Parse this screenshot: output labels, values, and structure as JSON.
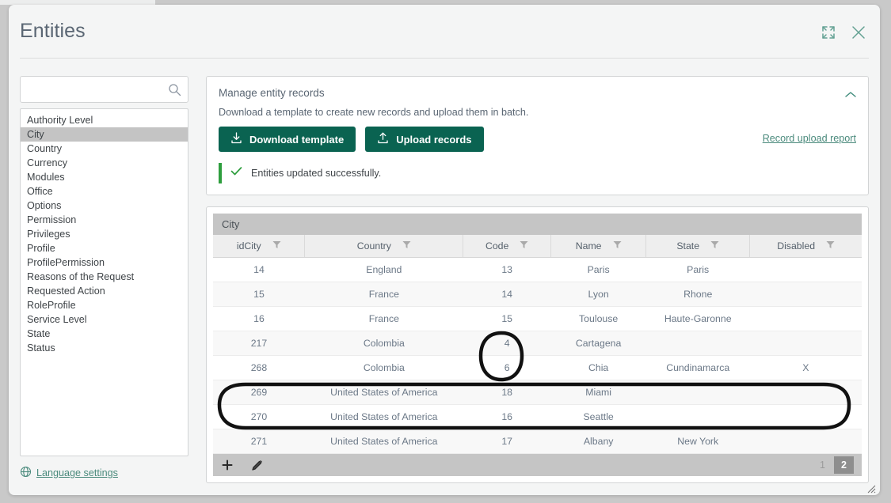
{
  "window": {
    "title": "Entities",
    "expand_icon": "expand-icon",
    "close_icon": "close-icon"
  },
  "sidebar": {
    "search": {
      "value": "",
      "placeholder": "",
      "icon": "search-icon"
    },
    "items": [
      {
        "label": "Authority Level",
        "selected": false
      },
      {
        "label": "City",
        "selected": true
      },
      {
        "label": "Country",
        "selected": false
      },
      {
        "label": "Currency",
        "selected": false
      },
      {
        "label": "Modules",
        "selected": false
      },
      {
        "label": "Office",
        "selected": false
      },
      {
        "label": "Options",
        "selected": false
      },
      {
        "label": "Permission",
        "selected": false
      },
      {
        "label": "Privileges",
        "selected": false
      },
      {
        "label": "Profile",
        "selected": false
      },
      {
        "label": "ProfilePermission",
        "selected": false
      },
      {
        "label": "Reasons of the Request",
        "selected": false
      },
      {
        "label": "Requested Action",
        "selected": false
      },
      {
        "label": "RoleProfile",
        "selected": false
      },
      {
        "label": "Service Level",
        "selected": false
      },
      {
        "label": "State",
        "selected": false
      },
      {
        "label": "Status",
        "selected": false
      }
    ],
    "language_settings": {
      "label": "Language settings",
      "icon": "globe-icon"
    }
  },
  "manage_panel": {
    "title": "Manage entity records",
    "subtitle": "Download a template to create new records and upload them in batch.",
    "download_button": "Download template",
    "upload_button": "Upload records",
    "report_link": "Record upload report",
    "success_message": "Entities updated successfully.",
    "collapse_icon": "chevron-up-icon"
  },
  "grid": {
    "title": "City",
    "columns": [
      {
        "label": "idCity",
        "filter_icon": "filter-icon"
      },
      {
        "label": "Country",
        "filter_icon": "filter-icon"
      },
      {
        "label": "Code",
        "filter_icon": "filter-icon"
      },
      {
        "label": "Name",
        "filter_icon": "filter-icon"
      },
      {
        "label": "State",
        "filter_icon": "filter-icon"
      },
      {
        "label": "Disabled",
        "filter_icon": "filter-icon"
      }
    ],
    "rows": [
      {
        "idCity": "14",
        "Country": "England",
        "Code": "13",
        "Name": "Paris",
        "State": "Paris",
        "Disabled": ""
      },
      {
        "idCity": "15",
        "Country": "France",
        "Code": "14",
        "Name": "Lyon",
        "State": "Rhone",
        "Disabled": ""
      },
      {
        "idCity": "16",
        "Country": "France",
        "Code": "15",
        "Name": "Toulouse",
        "State": "Haute-Garonne",
        "Disabled": ""
      },
      {
        "idCity": "217",
        "Country": "Colombia",
        "Code": "4",
        "Name": "Cartagena",
        "State": "",
        "Disabled": ""
      },
      {
        "idCity": "268",
        "Country": "Colombia",
        "Code": "6",
        "Name": "Chia",
        "State": "Cundinamarca",
        "Disabled": "X"
      },
      {
        "idCity": "269",
        "Country": "United States of America",
        "Code": "18",
        "Name": "Miami",
        "State": "",
        "Disabled": ""
      },
      {
        "idCity": "270",
        "Country": "United States of America",
        "Code": "16",
        "Name": "Seattle",
        "State": "",
        "Disabled": ""
      },
      {
        "idCity": "271",
        "Country": "United States of America",
        "Code": "17",
        "Name": "Albany",
        "State": "New York",
        "Disabled": ""
      }
    ],
    "footer": {
      "add_icon": "plus-icon",
      "edit_icon": "pencil-icon",
      "pages": [
        {
          "label": "1",
          "active": false
        },
        {
          "label": "2",
          "active": true
        }
      ]
    }
  },
  "annotations": {
    "code_ellipse": "hand-drawn-oval-around-code-values",
    "rows_ellipse": "hand-drawn-oval-around-rows-270-271",
    "color": "#111111"
  },
  "colors": {
    "accent_green": "#0a6351",
    "link_teal": "#4a8a7c",
    "success_green": "#2e9e3e",
    "header_text": "#5a6673"
  },
  "resize_grip": "resize-grip-icon"
}
